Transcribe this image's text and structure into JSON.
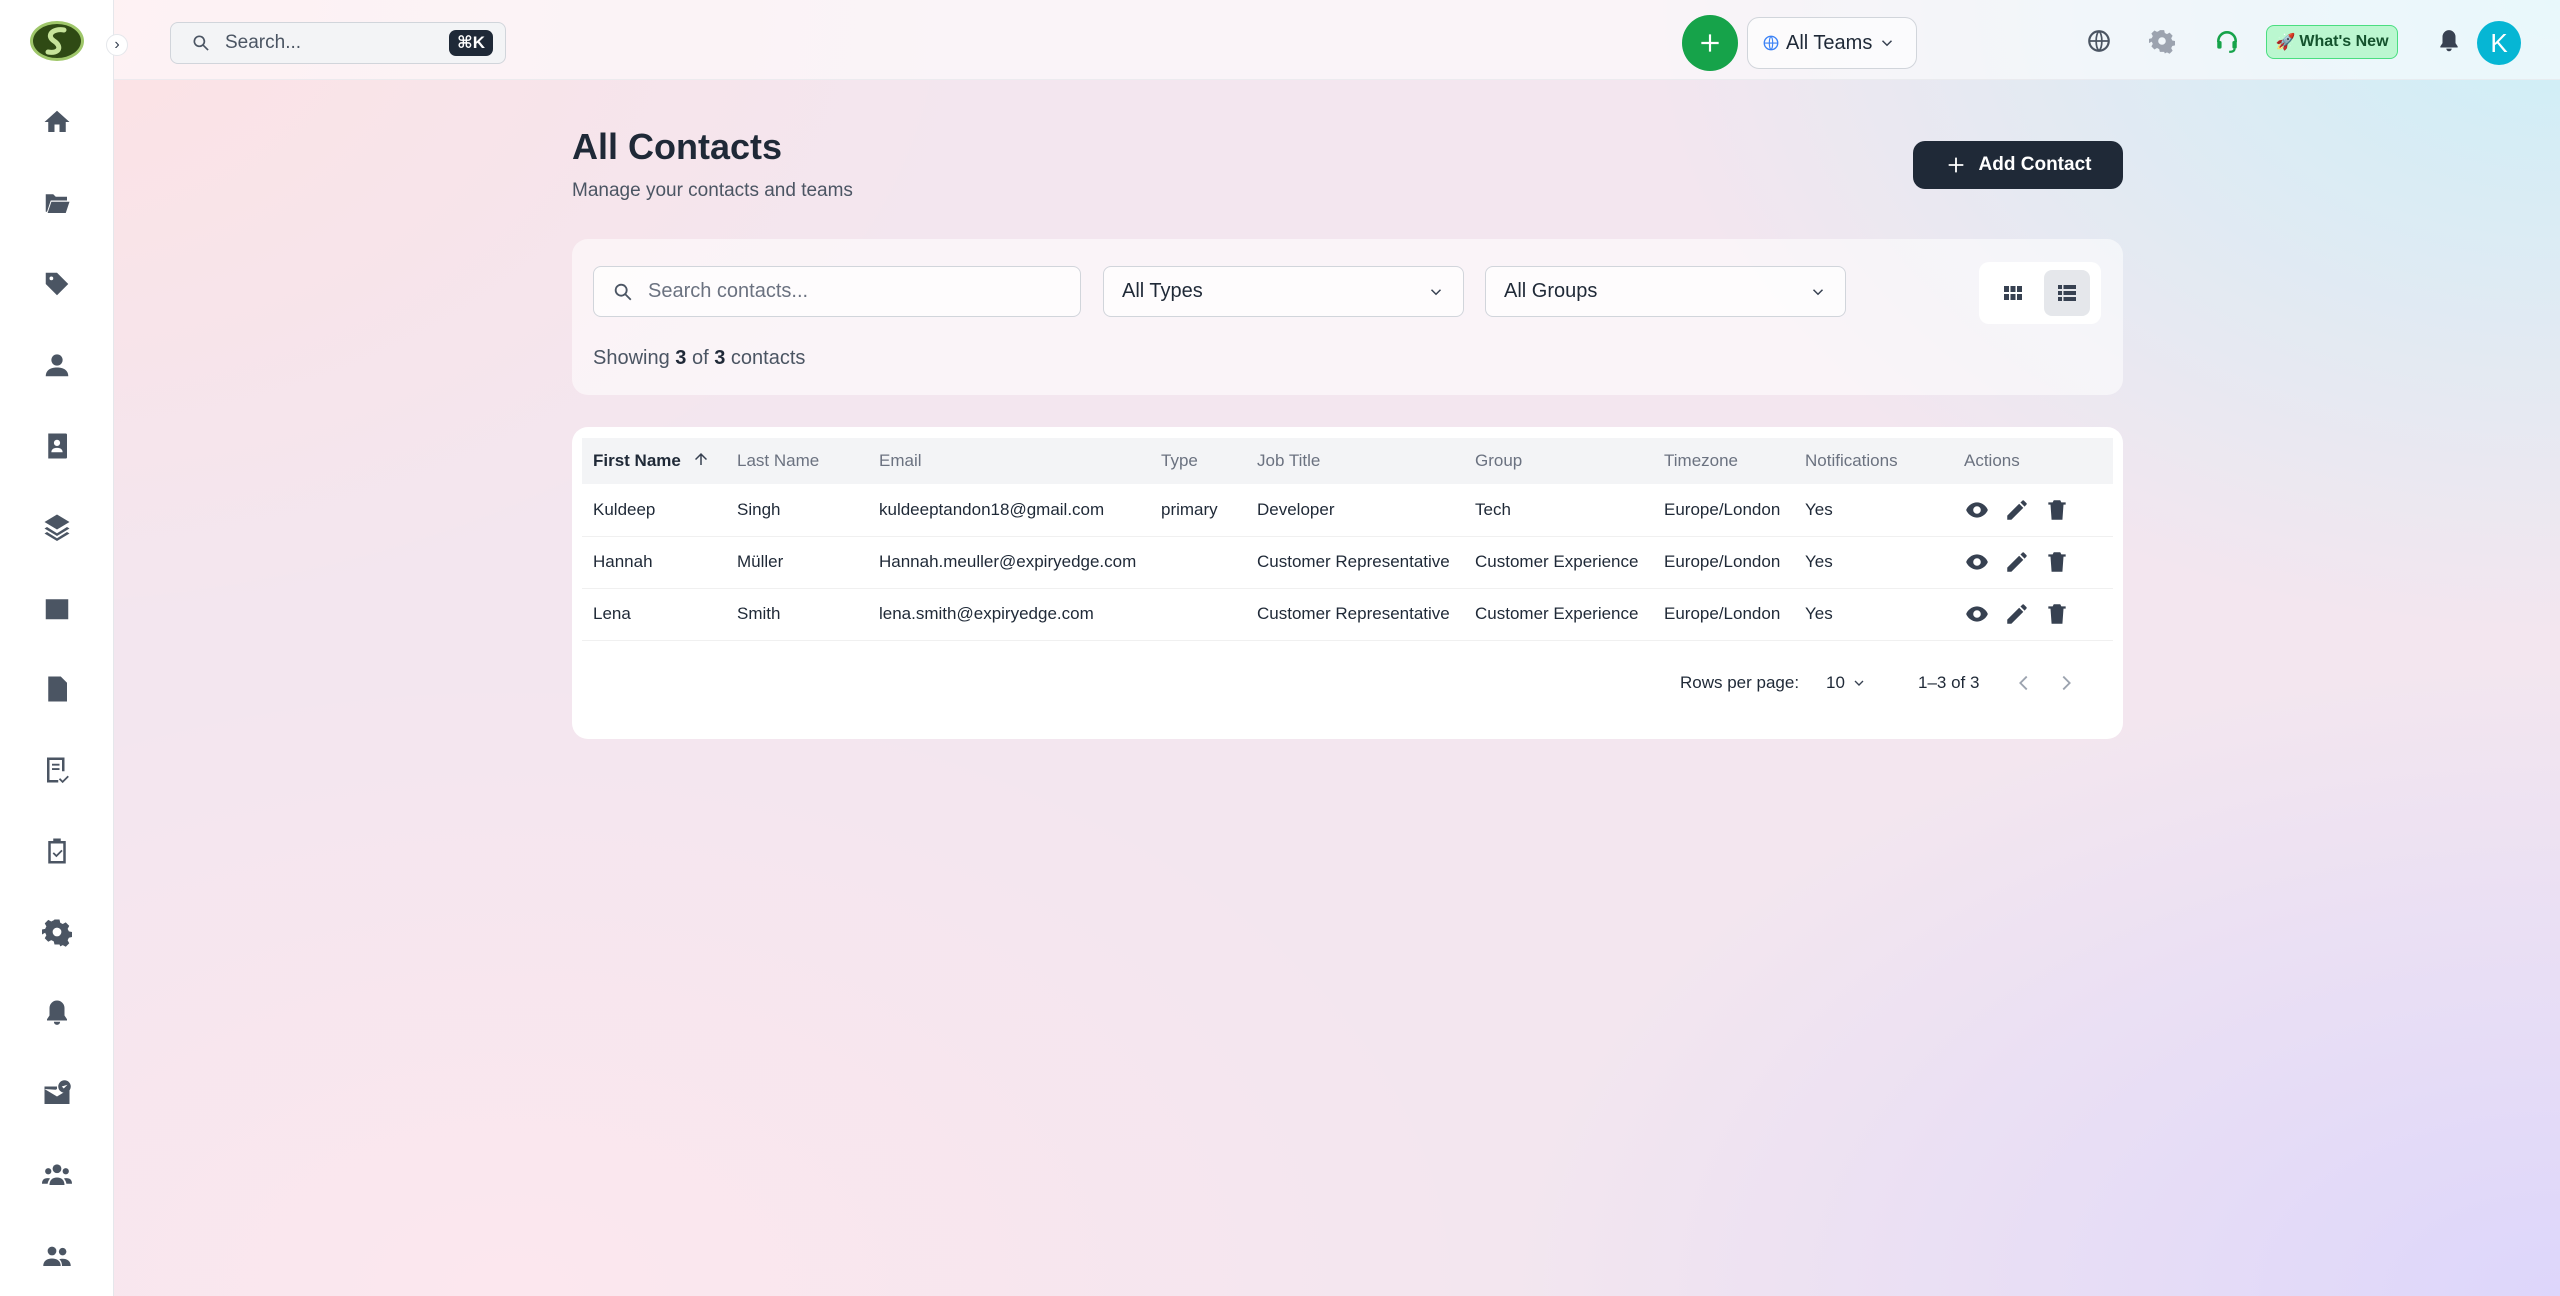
{
  "topbar": {
    "search_placeholder": "Search...",
    "search_shortcut": "⌘K",
    "team_select": "All Teams",
    "whats_new": "What's New",
    "whats_new_emoji": "🚀",
    "avatar_initial": "K"
  },
  "sidebar": {
    "items": [
      {
        "icon": "home-icon"
      },
      {
        "icon": "folder-icon"
      },
      {
        "icon": "tag-icon"
      },
      {
        "icon": "person-icon"
      },
      {
        "icon": "contacts-book-icon"
      },
      {
        "icon": "layers-icon"
      },
      {
        "icon": "calendar-icon"
      },
      {
        "icon": "document-icon"
      },
      {
        "icon": "checklist-icon"
      },
      {
        "icon": "clipboard-check-icon"
      },
      {
        "icon": "gear-icon"
      },
      {
        "icon": "bell-icon"
      },
      {
        "icon": "mail-check-icon"
      },
      {
        "icon": "groups-icon"
      },
      {
        "icon": "people-icon"
      }
    ]
  },
  "page": {
    "title": "All Contacts",
    "subtitle": "Manage your contacts and teams",
    "add_button": "Add Contact"
  },
  "filters": {
    "search_placeholder": "Search contacts...",
    "type_select": "All Types",
    "group_select": "All Groups",
    "showing_prefix": "Showing",
    "showing_count": "3",
    "showing_of": "of",
    "showing_total": "3",
    "showing_suffix": "contacts"
  },
  "table": {
    "columns": [
      "First Name",
      "Last Name",
      "Email",
      "Type",
      "Job Title",
      "Group",
      "Timezone",
      "Notifications",
      "Actions"
    ],
    "rows": [
      {
        "first": "Kuldeep",
        "last": "Singh",
        "email": "kuldeeptandon18@gmail.com",
        "type": "primary",
        "job": "Developer",
        "group": "Tech",
        "tz": "Europe/London",
        "notif": "Yes"
      },
      {
        "first": "Hannah",
        "last": "Müller",
        "email": "Hannah.meuller@expiryedge.com",
        "type": "",
        "job": "Customer Representative",
        "group": "Customer Experience",
        "tz": "Europe/London",
        "notif": "Yes"
      },
      {
        "first": "Lena",
        "last": "Smith",
        "email": "lena.smith@expiryedge.com",
        "type": "",
        "job": "Customer Representative",
        "group": "Customer Experience",
        "tz": "Europe/London",
        "notif": "Yes"
      }
    ],
    "rows_per_page_label": "Rows per page:",
    "rows_per_page": "10",
    "range": "1–3 of 3"
  },
  "colors": {
    "primary_dark": "#1f2937",
    "accent_green": "#16a34a",
    "avatar": "#06b6d4",
    "whats_new_bg": "#bbf7d0"
  }
}
